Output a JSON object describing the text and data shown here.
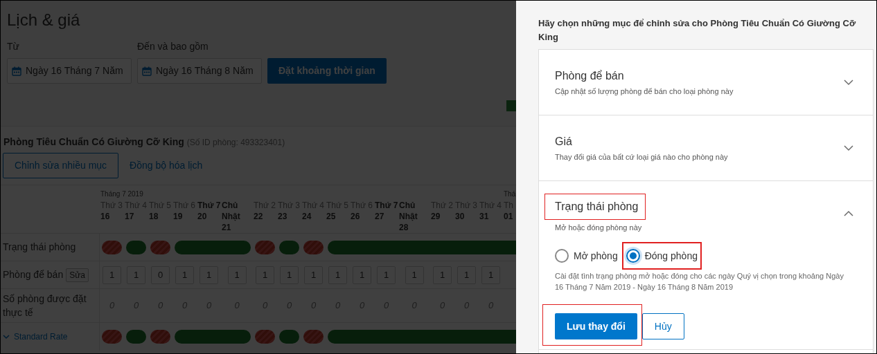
{
  "page": {
    "title": "Lịch & giá",
    "from_label": "Từ",
    "from_value": "Ngày 16 Tháng 7 Năm",
    "to_label": "Đến và bao gồm",
    "to_value": "Ngày 16 Tháng 8 Năm",
    "set_button": "Đặt khoảng thời gian"
  },
  "room": {
    "name": "Phòng Tiêu Chuẩn Có Giường Cỡ King",
    "id_note": "(Số ID phòng: 493323401)",
    "edit_button": "Chỉnh sửa nhiều mục",
    "sync_link": "Đồng bộ hóa lịch"
  },
  "calendar": {
    "row_labels": {
      "status": "Trạng thái phòng",
      "rooms": "Phòng để bán",
      "rooms_button": "Sửa",
      "booked": "Số phòng được đặt thực tế",
      "rate": "Standard Rate"
    },
    "rate_expanded": true,
    "days": [
      {
        "month": "Tháng 7 2019",
        "weekday": "Thứ 3",
        "date": "16",
        "weekend": false,
        "closed": true,
        "rooms": "1",
        "booked": "0"
      },
      {
        "weekday": "Thứ 4",
        "date": "17",
        "weekend": false,
        "closed": false,
        "rooms": "1",
        "booked": "0"
      },
      {
        "weekday": "Thứ 5",
        "date": "18",
        "weekend": false,
        "closed": true,
        "rooms": "0",
        "booked": "0"
      },
      {
        "weekday": "Thứ 6",
        "date": "19",
        "weekend": false,
        "closed": false,
        "rooms": "1",
        "booked": "0"
      },
      {
        "weekday": "Thứ 7",
        "date": "20",
        "weekend": true,
        "closed": false,
        "rooms": "1",
        "booked": "0"
      },
      {
        "weekday": "Chủ Nhật",
        "date": "21",
        "weekend": true,
        "closed": false,
        "rooms": "1",
        "booked": "0"
      },
      {
        "weekday": "Thứ 2",
        "date": "22",
        "weekend": false,
        "closed": true,
        "rooms": "1",
        "booked": "0"
      },
      {
        "weekday": "Thứ 3",
        "date": "23",
        "weekend": false,
        "closed": false,
        "rooms": "1",
        "booked": "0"
      },
      {
        "weekday": "Thứ 4",
        "date": "24",
        "weekend": false,
        "closed": true,
        "rooms": "1",
        "booked": "0"
      },
      {
        "weekday": "Thứ 5",
        "date": "25",
        "weekend": false,
        "closed": false,
        "rooms": "1",
        "booked": "0"
      },
      {
        "weekday": "Thứ 6",
        "date": "26",
        "weekend": false,
        "closed": false,
        "rooms": "1",
        "booked": "0"
      },
      {
        "weekday": "Thứ 7",
        "date": "27",
        "weekend": true,
        "closed": false,
        "rooms": "1",
        "booked": "0"
      },
      {
        "weekday": "Chủ Nhật",
        "date": "28",
        "weekend": true,
        "closed": false,
        "rooms": "1",
        "booked": "0"
      },
      {
        "weekday": "Thứ 2",
        "date": "29",
        "weekend": false,
        "closed": false,
        "rooms": "1",
        "booked": "0"
      },
      {
        "weekday": "Thứ 3",
        "date": "30",
        "weekend": false,
        "closed": false,
        "rooms": "1",
        "booked": "0"
      },
      {
        "weekday": "Thứ 4",
        "date": "31",
        "weekend": false,
        "closed": false,
        "rooms": "1",
        "booked": "0"
      },
      {
        "month": "Thá",
        "weekday": "Th",
        "date": "01",
        "weekend": false,
        "closed": false
      }
    ]
  },
  "panel": {
    "heading": "Hãy chọn những mục để chỉnh sửa cho Phòng Tiêu Chuẩn Có Giường Cỡ King",
    "sections": [
      {
        "title": "Phòng để bán",
        "subtitle": "Cập nhật số lượng phòng để bán cho loại phòng này",
        "expanded": false,
        "annotated": false
      },
      {
        "title": "Giá",
        "subtitle": "Thay đổi giá của bất cứ loại giá nào cho phòng này",
        "expanded": false,
        "annotated": false
      },
      {
        "title": "Trạng thái phòng",
        "subtitle": "Mở hoặc đóng phòng này",
        "expanded": true,
        "annotated": true
      }
    ],
    "status_options": [
      {
        "label": "Mở phòng",
        "selected": false,
        "annotated": false
      },
      {
        "label": "Đóng phòng",
        "selected": true,
        "annotated": true
      }
    ],
    "note": "Cài đặt tình trạng phòng mở hoặc đóng cho các ngày Quý vị chọn trong khoảng Ngày 16 Tháng 7 Năm 2019 - Ngày 16 Tháng 8 Năm 2019",
    "save_button": "Lưu thay đổi",
    "cancel_button": "Hủy",
    "actions_annotated": true
  }
}
